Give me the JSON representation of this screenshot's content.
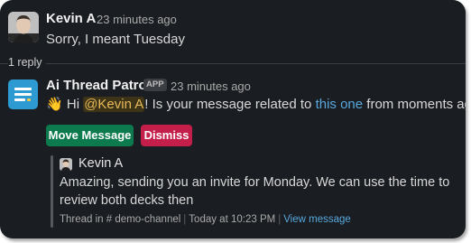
{
  "message": {
    "author": "Kevin A",
    "time": "23 minutes ago",
    "text": "Sorry, I meant Tuesday"
  },
  "thread": {
    "reply_count": "1 reply"
  },
  "reply": {
    "author": "Ai Thread Patrol",
    "badge": "APP",
    "time": "23 minutes ago",
    "emoji": "👋",
    "text_pre": "Hi ",
    "mention": "@Kevin A",
    "text_mid": "! Is your message related to ",
    "link": "this one",
    "text_post": " from moments ago?",
    "buttons": {
      "move": "Move Message",
      "dismiss": "Dismiss"
    }
  },
  "quoted": {
    "author": "Kevin A",
    "line1": "Amazing, sending you an invite for Monday. We can use the time to",
    "line2": "review both decks then",
    "meta": {
      "thread_in": "Thread in",
      "channel_hash": "#",
      "channel": "demo-channel",
      "when": "Today at 10:23 PM",
      "view": "View message"
    }
  },
  "colors": {
    "background": "#1a1d21",
    "move_button": "#0d7a4e",
    "dismiss_button": "#c41e4b",
    "link": "#58a8de",
    "mention": "#e8b95a",
    "app_avatar": "#2d9bd1"
  }
}
